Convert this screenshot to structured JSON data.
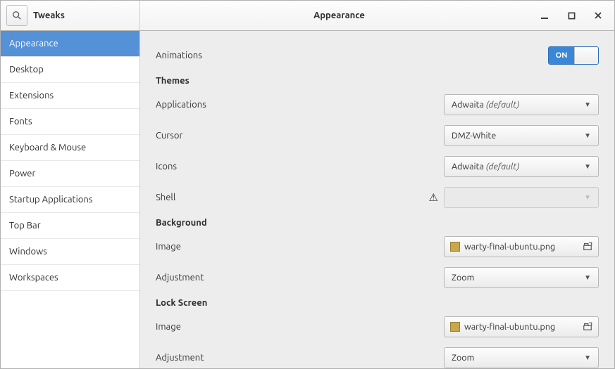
{
  "titlebar": {
    "app_title": "Tweaks",
    "page_title": "Appearance"
  },
  "sidebar": {
    "items": [
      "Appearance",
      "Desktop",
      "Extensions",
      "Fonts",
      "Keyboard & Mouse",
      "Power",
      "Startup Applications",
      "Top Bar",
      "Windows",
      "Workspaces"
    ],
    "selected_index": 0
  },
  "content": {
    "animations": {
      "label": "Animations",
      "switch": "ON"
    },
    "sections": {
      "themes": {
        "title": "Themes",
        "rows": {
          "applications": {
            "label": "Applications",
            "value": "Adwaita",
            "default": true
          },
          "cursor": {
            "label": "Cursor",
            "value": "DMZ-White",
            "default": false
          },
          "icons": {
            "label": "Icons",
            "value": "Adwaita",
            "default": true
          },
          "shell": {
            "label": "Shell",
            "value": "",
            "warning": true,
            "disabled": true
          }
        }
      },
      "background": {
        "title": "Background",
        "rows": {
          "image": {
            "label": "Image",
            "file": "warty-final-ubuntu.png"
          },
          "adjustment": {
            "label": "Adjustment",
            "value": "Zoom"
          }
        }
      },
      "lockscreen": {
        "title": "Lock Screen",
        "rows": {
          "image": {
            "label": "Image",
            "file": "warty-final-ubuntu.png"
          },
          "adjustment": {
            "label": "Adjustment",
            "value": "Zoom"
          }
        }
      }
    },
    "default_suffix": "(default)"
  }
}
